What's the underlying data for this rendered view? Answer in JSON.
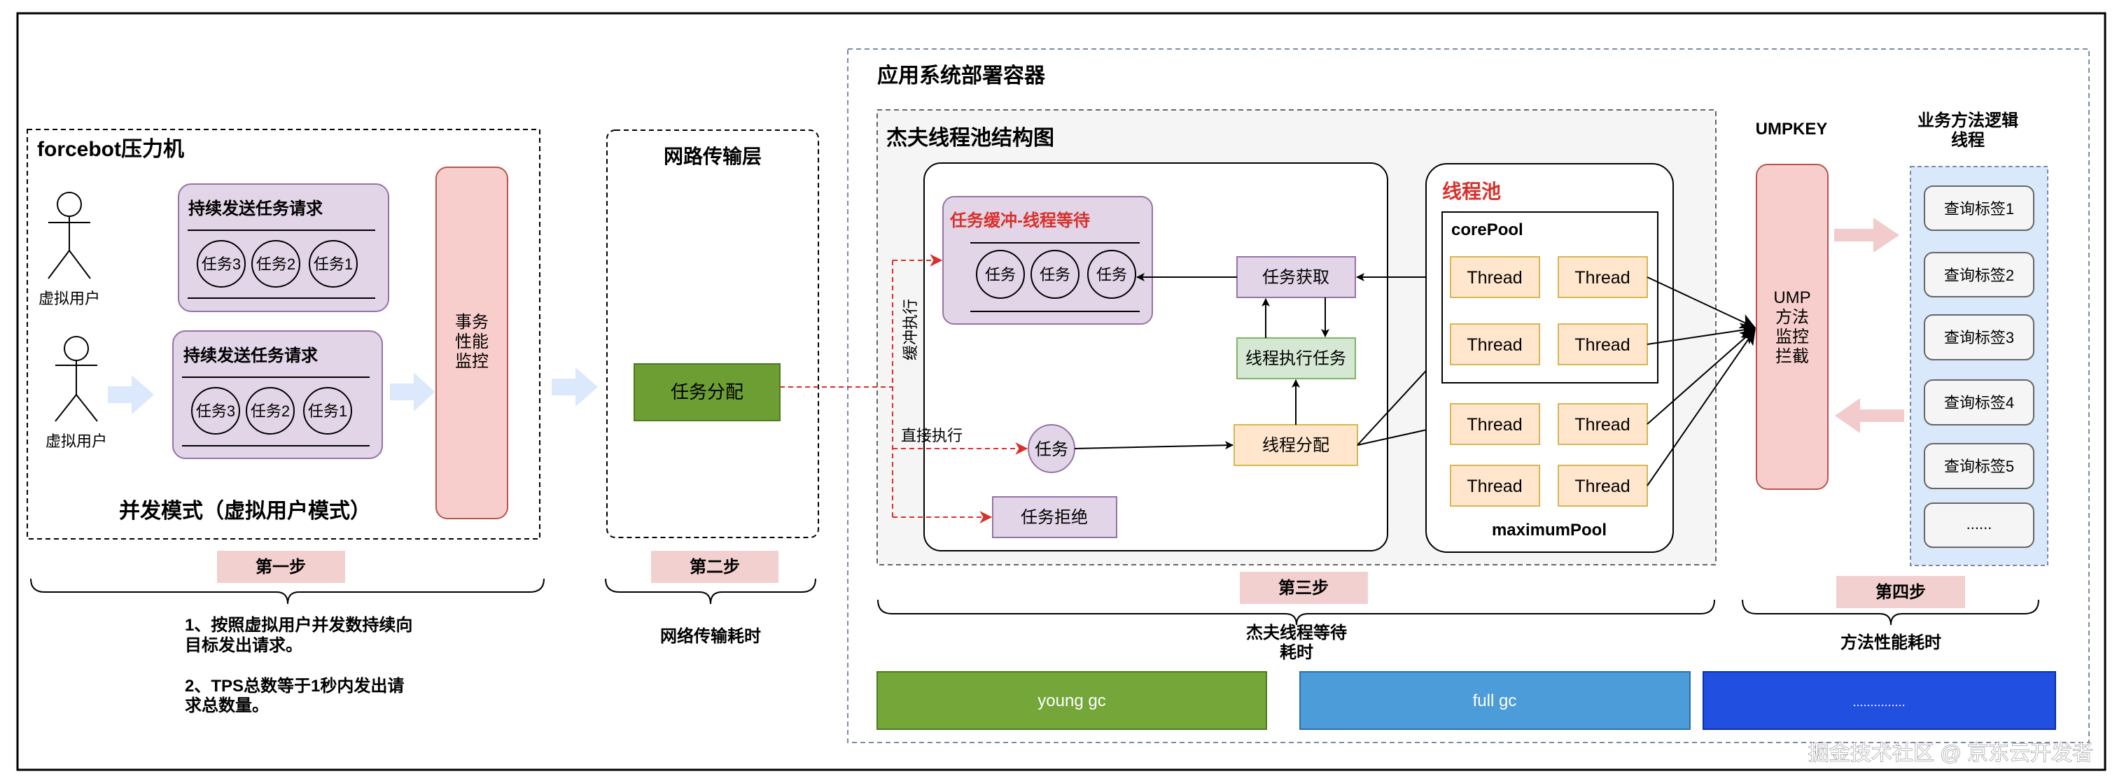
{
  "colors": {
    "purple_fill": "#e1d5e7",
    "purple_stroke": "#9673a6",
    "pink_fill": "#f8cecc",
    "pink_stroke": "#b85450",
    "step_fill": "#f2d0cf",
    "green_fill": "#6d9e34",
    "green_stroke": "#4e7a22",
    "light_green_fill": "#d5e8d4",
    "light_green_stroke": "#82b366",
    "orange_fill": "#ffe6cc",
    "orange_stroke": "#d6b656",
    "blue_col_fill": "#dae8fc",
    "blue_arrow": "#dce8fb",
    "red_dash": "#d9302a",
    "gray_container": "#f5f5f5",
    "young_gc": "#74a63a",
    "full_gc": "#4b9cd9",
    "more_gc": "#2150e0"
  },
  "forcebot": {
    "title": "forcebot压力机",
    "actors": [
      {
        "label": "虚拟用户"
      },
      {
        "label": "虚拟用户"
      }
    ],
    "cards": [
      {
        "title": "持续发送任务请求",
        "tasks": [
          "任务3",
          "任务2",
          "任务1"
        ]
      },
      {
        "title": "持续发送任务请求",
        "tasks": [
          "任务3",
          "任务2",
          "任务1"
        ]
      }
    ],
    "monitor_lines": [
      "事务",
      "性能",
      "监控"
    ],
    "mode_label": "并发模式（虚拟用户模式）"
  },
  "network": {
    "title": "网路传输层",
    "dispatch_label": "任务分配"
  },
  "app_container": {
    "title": "应用系统部署容器",
    "jeff_pool": {
      "title": "杰夫线程池结构图",
      "buffer_title": "任务缓冲-线程等待",
      "buffer_tasks": [
        "任务",
        "任务",
        "任务"
      ],
      "task_fetch": "任务获取",
      "thread_exec": "线程执行任务",
      "thread_assign": "线程分配",
      "task_node": "任务",
      "task_reject": "任务拒绝",
      "buffer_exec_label": "缓冲执行",
      "direct_exec_label": "直接执行"
    },
    "thread_pool": {
      "title": "线程池",
      "core_label": "corePool",
      "max_label": "maximumPool",
      "threads": [
        "Thread",
        "Thread",
        "Thread",
        "Thread",
        "Thread",
        "Thread",
        "Thread",
        "Thread"
      ]
    },
    "ump": {
      "title": "UMPKEY",
      "lines": [
        "UMP",
        "方法",
        "监控",
        "拦截"
      ]
    },
    "business": {
      "title_lines": [
        "业务方法逻辑",
        "线程"
      ],
      "tags": [
        "查询标签1",
        "查询标签2",
        "查询标签3",
        "查询标签4",
        "查询标签5",
        "......"
      ]
    },
    "gc_bars": [
      {
        "label": "young gc"
      },
      {
        "label": "full gc"
      },
      {
        "label": "..............."
      }
    ]
  },
  "steps": [
    {
      "label": "第一步",
      "desc_lines": [
        "1、按照虚拟用户并发数持续向",
        "目标发出请求。",
        "",
        "2、TPS总数等于1秒内发出请",
        "求总数量。"
      ]
    },
    {
      "label": "第二步",
      "desc_lines": [
        "网络传输耗时"
      ]
    },
    {
      "label": "第三步",
      "desc_lines": [
        "杰夫线程等待",
        "耗时"
      ]
    },
    {
      "label": "第四步",
      "desc_lines": [
        "方法性能耗时"
      ]
    }
  ],
  "watermark": "掘金技术社区 @ 京东云开发者"
}
